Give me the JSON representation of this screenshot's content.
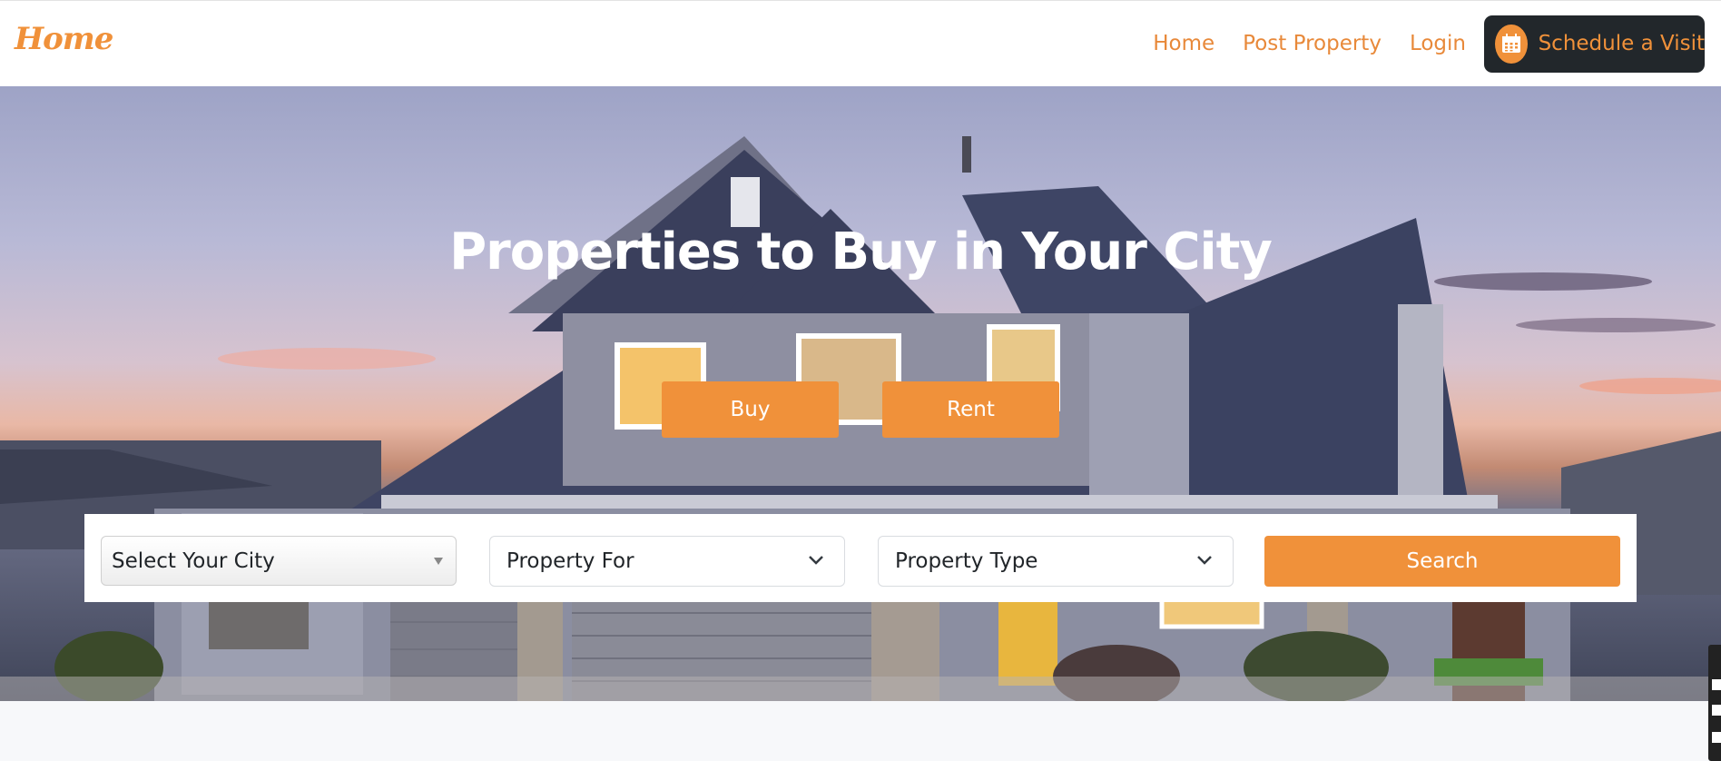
{
  "brand": {
    "logo_text": "Home"
  },
  "nav": {
    "links": [
      "Home",
      "Post Property",
      "Login"
    ],
    "cta": {
      "label": "Schedule a Visit",
      "icon": "calendar-icon"
    }
  },
  "hero": {
    "title": "Properties to Buy in Your City",
    "buttons": {
      "buy": "Buy",
      "rent": "Rent"
    }
  },
  "search": {
    "city_select": {
      "selected": "Select Your City"
    },
    "property_for_select": {
      "selected": "Property For"
    },
    "property_type_select": {
      "selected": "Property Type"
    },
    "submit_label": "Search"
  },
  "colors": {
    "accent": "#f0913a",
    "dark_button": "#22272b",
    "navbar_bg": "#ffffff",
    "page_bg": "#f7f8fa"
  }
}
